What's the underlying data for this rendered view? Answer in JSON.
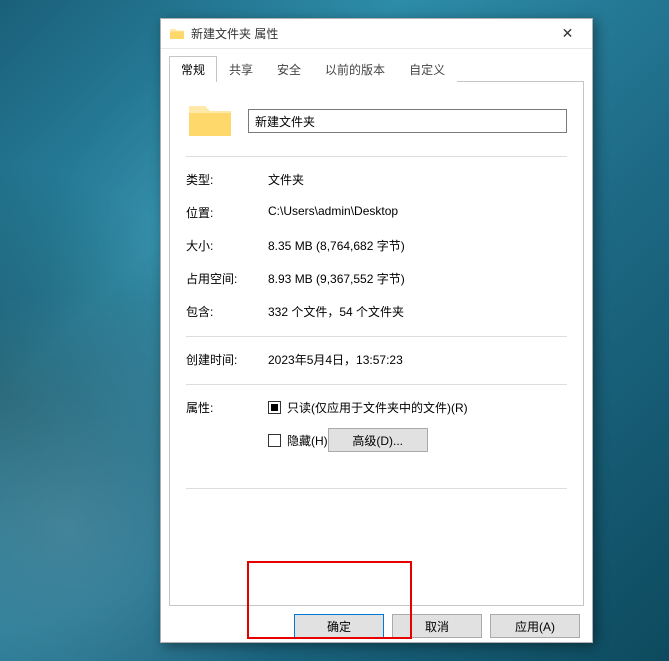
{
  "window": {
    "title": "新建文件夹 属性",
    "close_icon": "✕"
  },
  "tabs": {
    "general": "常规",
    "share": "共享",
    "security": "安全",
    "previous": "以前的版本",
    "custom": "自定义"
  },
  "folder_name": "新建文件夹",
  "labels": {
    "type": "类型:",
    "location": "位置:",
    "size": "大小:",
    "size_on_disk": "占用空间:",
    "contains": "包含:",
    "created": "创建时间:",
    "attributes": "属性:",
    "readonly": "只读(仅应用于文件夹中的文件)(R)",
    "hidden": "隐藏(H)",
    "advanced": "高级(D)..."
  },
  "values": {
    "type": "文件夹",
    "location": "C:\\Users\\admin\\Desktop",
    "size": "8.35 MB (8,764,682 字节)",
    "size_on_disk": "8.93 MB (9,367,552 字节)",
    "contains": "332 个文件，54 个文件夹",
    "created": "2023年5月4日，13:57:23"
  },
  "buttons": {
    "ok": "确定",
    "cancel": "取消",
    "apply": "应用(A)"
  }
}
